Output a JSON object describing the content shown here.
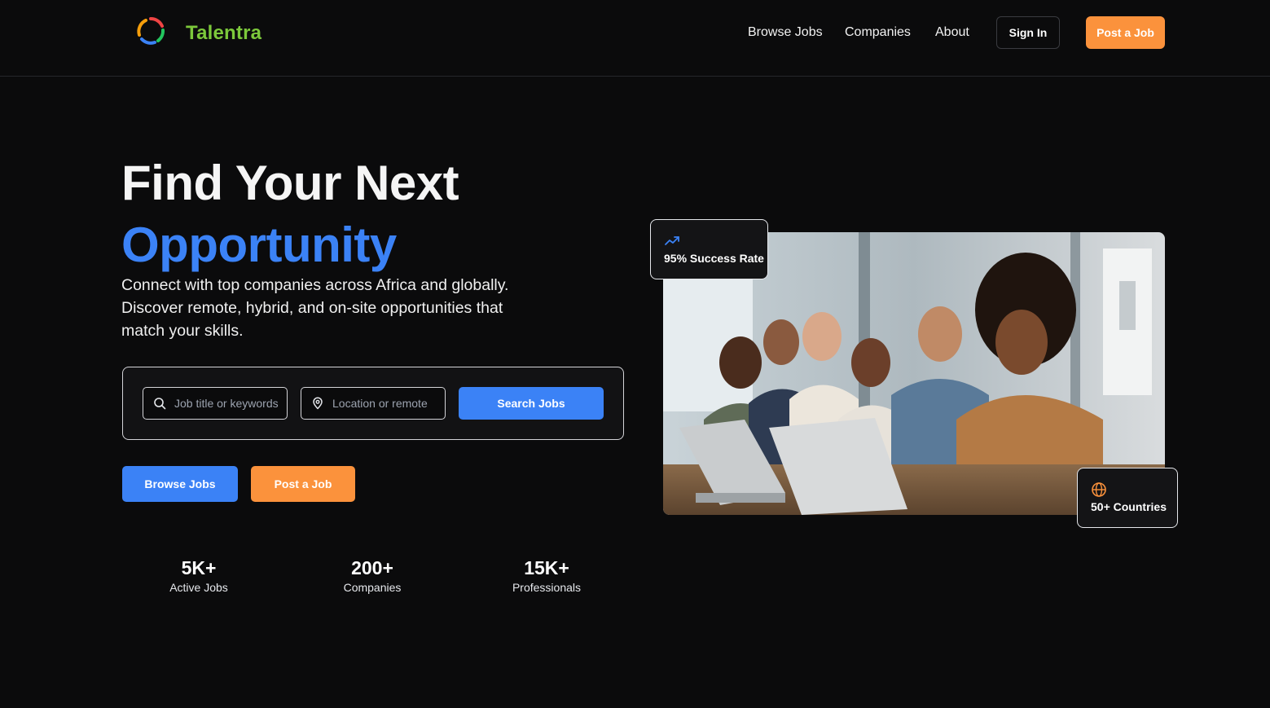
{
  "header": {
    "brand": "Talentra",
    "nav": {
      "browse_jobs": "Browse Jobs",
      "companies": "Companies",
      "about": "About"
    },
    "sign_in": "Sign In",
    "post_job": "Post a Job"
  },
  "hero": {
    "title_line1": "Find Your Next",
    "title_line2": "Opportunity",
    "description": "Connect with top companies across Africa and globally. Discover remote, hybrid, and on-site opportunities that match your skills."
  },
  "search": {
    "job_placeholder": "Job title or keywords",
    "location_placeholder": "Location or remote",
    "button": "Search Jobs"
  },
  "cta": {
    "browse_jobs": "Browse Jobs",
    "post_job": "Post a Job"
  },
  "stats": [
    {
      "value": "5K+",
      "label": "Active Jobs"
    },
    {
      "value": "200+",
      "label": "Companies"
    },
    {
      "value": "15K+",
      "label": "Professionals"
    }
  ],
  "badges": {
    "success": {
      "icon": "trending-up-icon",
      "text": "95% Success Rate"
    },
    "countries": {
      "icon": "globe-icon",
      "text": "50+ Countries"
    }
  },
  "colors": {
    "background": "#0b0b0c",
    "brand_green": "#7cc83b",
    "accent_blue": "#3b82f6",
    "accent_orange": "#fb923c"
  }
}
